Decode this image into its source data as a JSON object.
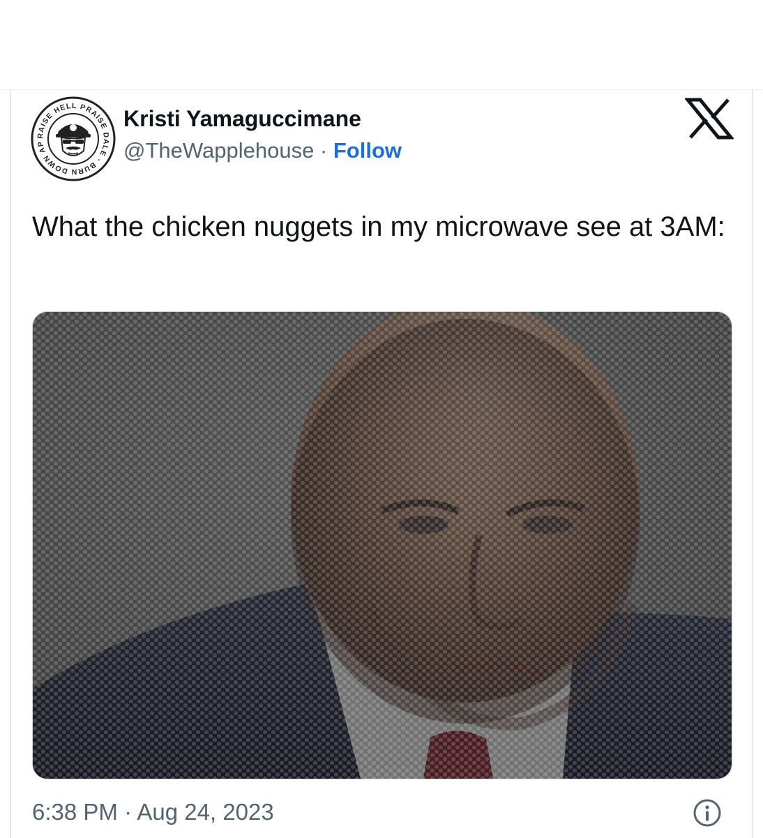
{
  "tweet": {
    "author": {
      "display_name": "Kristi Yamaguccimane",
      "handle": "@TheWapplehouse",
      "separator": " · ",
      "follow_label": "Follow",
      "avatar": {
        "icon": "restaurant-seal-avatar",
        "ring_text": "RAISE HELL PRAISE DALE · BURN DOWN APPLEBEE'S",
        "colors": {
          "ring": "#222222",
          "fill": "#ffffff"
        }
      }
    },
    "platform_icon": "x-logo-icon",
    "text": "What the chicken nuggets in my microwave see at 3AM:",
    "media": {
      "icon": "photo-behind-microwave-mesh",
      "colors": {
        "wall": "#8f9091",
        "skin": "#a07a62",
        "suit": "#2b2f45",
        "shirt": "#e8e6e6",
        "tie": "#8a2630"
      }
    },
    "timestamp": "6:38 PM · Aug 24, 2023",
    "info_icon": "info-icon"
  },
  "colors": {
    "text_primary": "#0f1419",
    "text_secondary": "#536471",
    "link": "#1d6fd6"
  }
}
